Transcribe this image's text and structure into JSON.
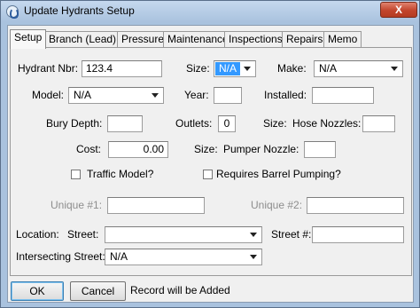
{
  "window": {
    "title": "Update Hydrants Setup",
    "close_label": "X"
  },
  "tabs": [
    {
      "label": "Setup",
      "active": true
    },
    {
      "label": "Branch (Lead)"
    },
    {
      "label": "Pressures"
    },
    {
      "label": "Maintenance"
    },
    {
      "label": "Inspections"
    },
    {
      "label": "Repairs"
    },
    {
      "label": "Memo"
    }
  ],
  "form": {
    "hydrant_nbr": {
      "label": "Hydrant Nbr:",
      "value": "123.4"
    },
    "size": {
      "label": "Size:",
      "value": "N/A"
    },
    "make": {
      "label": "Make:",
      "value": "N/A"
    },
    "model": {
      "label": "Model:",
      "value": "N/A"
    },
    "year": {
      "label": "Year:",
      "value": ""
    },
    "installed": {
      "label": "Installed:",
      "value": ""
    },
    "bury_depth": {
      "label": "Bury Depth:",
      "value": ""
    },
    "outlets": {
      "label": "Outlets:",
      "value": "0"
    },
    "hose_nozzles": {
      "size_label": "Size:",
      "label": "Hose Nozzles:",
      "value": ""
    },
    "cost": {
      "label": "Cost:",
      "value": "0.00"
    },
    "pumper_nozzle": {
      "size_label": "Size:",
      "label": "Pumper Nozzle:",
      "value": ""
    },
    "traffic_model": {
      "label": "Traffic Model?",
      "checked": false
    },
    "requires_barrel_pumping": {
      "label": "Requires Barrel Pumping?",
      "checked": false
    },
    "unique1": {
      "label": "Unique #1:",
      "value": ""
    },
    "unique2": {
      "label": "Unique #2:",
      "value": ""
    },
    "location": {
      "label": "Location:",
      "street_label": "Street:",
      "street_value": "",
      "street_num_label": "Street #:",
      "street_num_value": ""
    },
    "intersecting_street": {
      "label": "Intersecting Street:",
      "value": "N/A"
    }
  },
  "footer": {
    "ok_label": "OK",
    "cancel_label": "Cancel",
    "status": "Record will be Added"
  },
  "colors": {
    "frame": "#a9c2de",
    "dialog": "#f0f0f0",
    "close_button": "#c2452c",
    "selection": "#3399ff"
  }
}
